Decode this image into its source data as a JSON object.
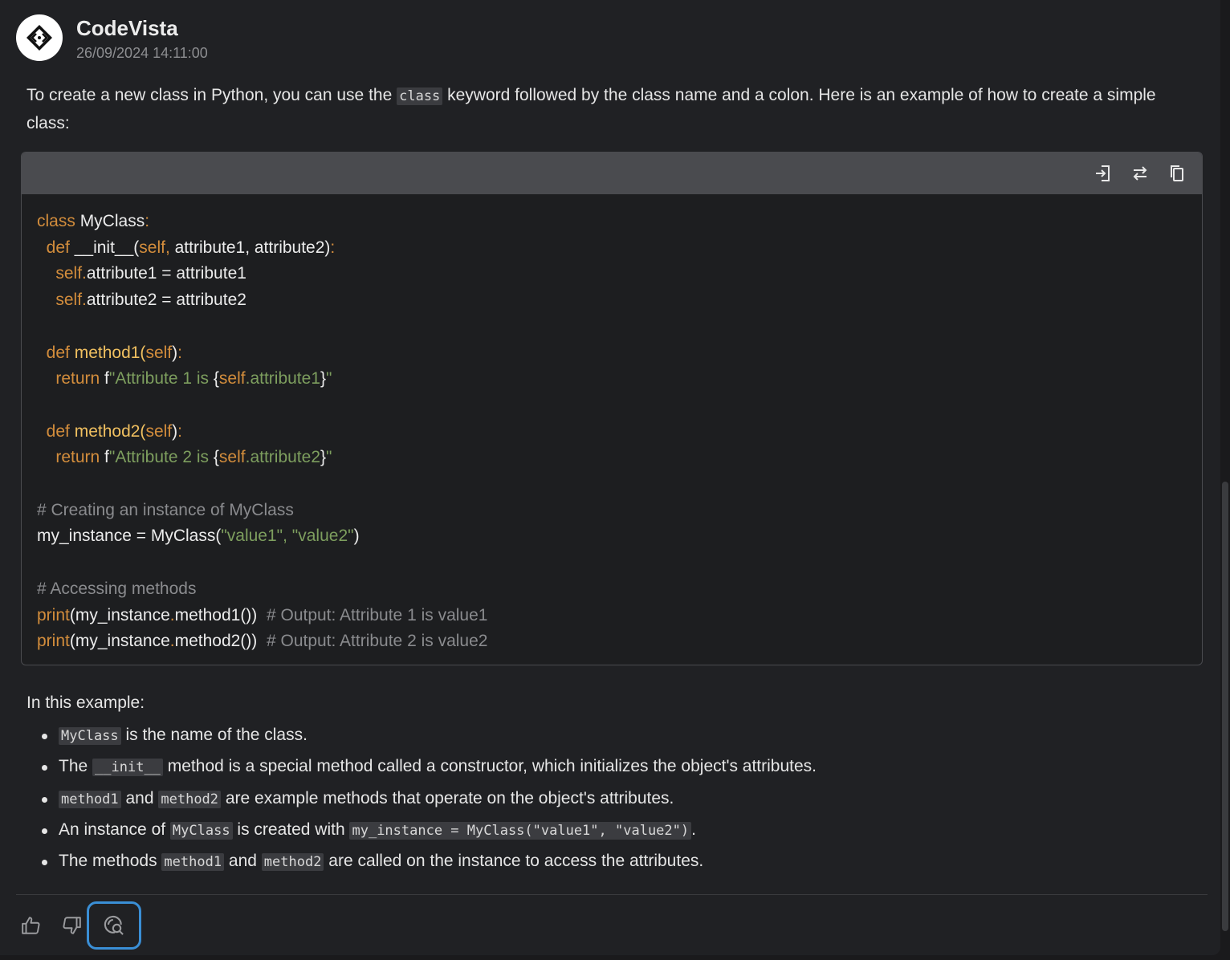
{
  "header": {
    "bot_name": "CodeVista",
    "timestamp": "26/09/2024 14:11:00",
    "avatar_icon": "code-brackets-icon"
  },
  "message": {
    "intro_before": "To create a new class in Python, you can use the ",
    "intro_code": "class",
    "intro_after": " keyword followed by the class name and a colon. Here is an example of how to create a simple class:"
  },
  "code_block": {
    "language": "python",
    "toolbar": {
      "insert_icon": "insert-icon",
      "diff_icon": "swap-arrows-icon",
      "copy_icon": "copy-icon"
    },
    "lines": [
      "class MyClass:",
      "    def __init__(self, attribute1, attribute2):",
      "        self.attribute1 = attribute1",
      "        self.attribute2 = attribute2",
      "",
      "    def method1(self):",
      "        return f\"Attribute 1 is {self.attribute1}\"",
      "",
      "    def method2(self):",
      "        return f\"Attribute 2 is {self.attribute2}\"",
      "",
      "# Creating an instance of MyClass",
      "my_instance = MyClass(\"value1\", \"value2\")",
      "",
      "# Accessing methods",
      "print(my_instance.method1())  # Output: Attribute 1 is value1",
      "print(my_instance.method2())  # Output: Attribute 2 is value2"
    ],
    "tokens": {
      "class_kw": "class",
      "class_name": " MyClass",
      "colon": ":",
      "def_kw": "def",
      "init_name": " __init__(",
      "self_kw": "self",
      "comma": ",",
      "init_args": " attribute1, attribute2)",
      "attr1_assign": "attribute1 = attribute1",
      "attr2_assign": "attribute2 = attribute2",
      "dot": ".",
      "method1_name": " method1(",
      "method2_name": " method2(",
      "close_paren": ")",
      "return_kw": "return",
      "f_prefix": " f",
      "str1_open": "\"Attribute 1 is ",
      "str2_open": "\"Attribute 2 is ",
      "brace_open": "{",
      "brace_close": "}",
      "self_attr1": "self.attribute1",
      "self_attr2": "self.attribute2",
      "quote": "\"",
      "comment1": "# Creating an instance of MyClass",
      "inst_assign": "my_instance = MyClass(",
      "str_value1": "\"value1\"",
      "comma_space": ", ",
      "str_value2": "\"value2\"",
      "comment2": "# Accessing methods",
      "print_kw": "print",
      "paren_open": "(",
      "my_instance": "my_instance",
      "call_method1": "method1())",
      "call_method2": "method2())",
      "out1": "  # Output: Attribute 1 is value1",
      "out2": "  # Output: Attribute 2 is value2"
    }
  },
  "explanation": {
    "intro": "In this example:",
    "b1_code": "MyClass",
    "b1_text": " is the name of the class.",
    "b2_pre": "The ",
    "b2_code": "__init__",
    "b2_text": " method is a special method called a constructor, which initializes the object's attributes.",
    "b3_code1": "method1",
    "b3_mid": " and ",
    "b3_code2": "method2",
    "b3_text": " are example methods that operate on the object's attributes.",
    "b4_pre": "An instance of ",
    "b4_code1": "MyClass",
    "b4_mid": " is created with ",
    "b4_code2": "my_instance = MyClass(\"value1\", \"value2\")",
    "b4_end": ".",
    "b5_pre": "The methods ",
    "b5_code1": "method1",
    "b5_mid": " and ",
    "b5_code2": "method2",
    "b5_text": " are called on the instance to access the attributes."
  },
  "feedback": {
    "thumbs_up_icon": "thumbs-up-icon",
    "thumbs_down_icon": "thumbs-down-icon",
    "inspect_icon": "search-inspect-icon",
    "active_color": "#3a8fd6"
  },
  "colors": {
    "keyword": "#d38d3c",
    "function": "#f0c060",
    "string": "#7d9e5e",
    "comment": "#8a8b8e",
    "background": "#202124"
  }
}
